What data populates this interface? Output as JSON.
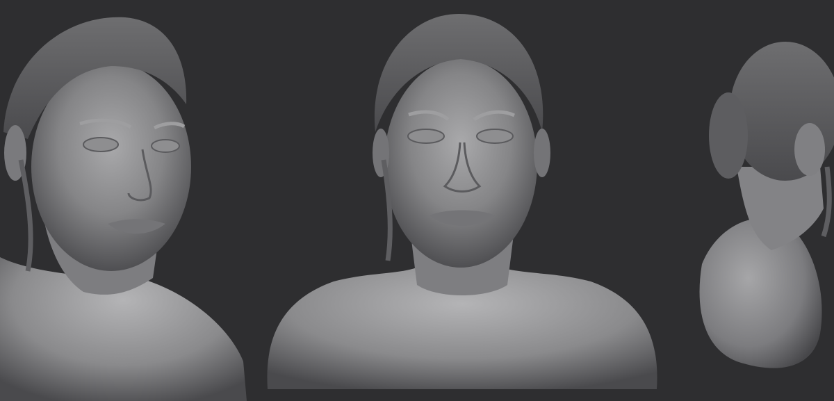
{
  "scene": {
    "background_color": "#2e2e30",
    "material": "clay-gray",
    "subject": "female-bust-sculpt",
    "views": [
      {
        "name": "three-quarter-view"
      },
      {
        "name": "front-view"
      },
      {
        "name": "back-three-quarter-view"
      }
    ]
  }
}
